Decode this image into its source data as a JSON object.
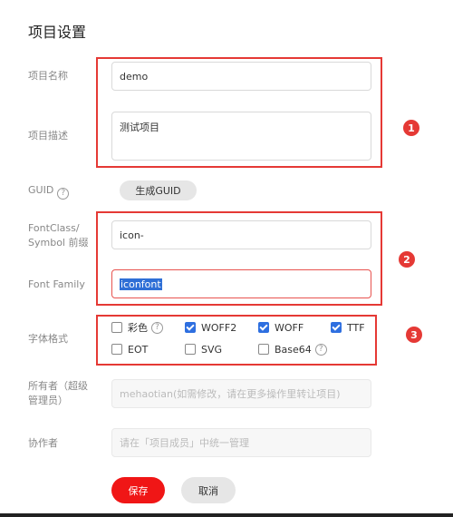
{
  "page": {
    "title": "项目设置"
  },
  "fields": {
    "name": {
      "label": "项目名称",
      "value": "demo"
    },
    "description": {
      "label": "项目描述",
      "value": "测试项目"
    },
    "guid": {
      "label": "GUID",
      "help": "?",
      "button": "生成GUID"
    },
    "font_class": {
      "label": "FontClass/ Symbol 前缀",
      "value": "icon-"
    },
    "font_family": {
      "label": "Font Family",
      "value": "iconfont"
    },
    "font_format": {
      "label": "字体格式",
      "options": [
        {
          "label": "彩色",
          "checked": false,
          "help": "?"
        },
        {
          "label": "WOFF2",
          "checked": true
        },
        {
          "label": "WOFF",
          "checked": true
        },
        {
          "label": "TTF",
          "checked": true
        },
        {
          "label": "EOT",
          "checked": false
        },
        {
          "label": "SVG",
          "checked": false
        },
        {
          "label": "Base64",
          "checked": false,
          "help": "?"
        }
      ]
    },
    "owner": {
      "label": "所有者（超级管理员）",
      "placeholder": "mehaotian(如需修改，请在更多操作里转让项目)"
    },
    "collaborators": {
      "label": "协作者",
      "placeholder": "请在「项目成员」中统一管理"
    }
  },
  "actions": {
    "save": "保存",
    "cancel": "取消"
  },
  "annotations": {
    "markers": [
      "1",
      "2",
      "3"
    ],
    "color": "#e53935"
  },
  "colors": {
    "primary": "#f01616",
    "checkbox": "#2e6fe0"
  }
}
